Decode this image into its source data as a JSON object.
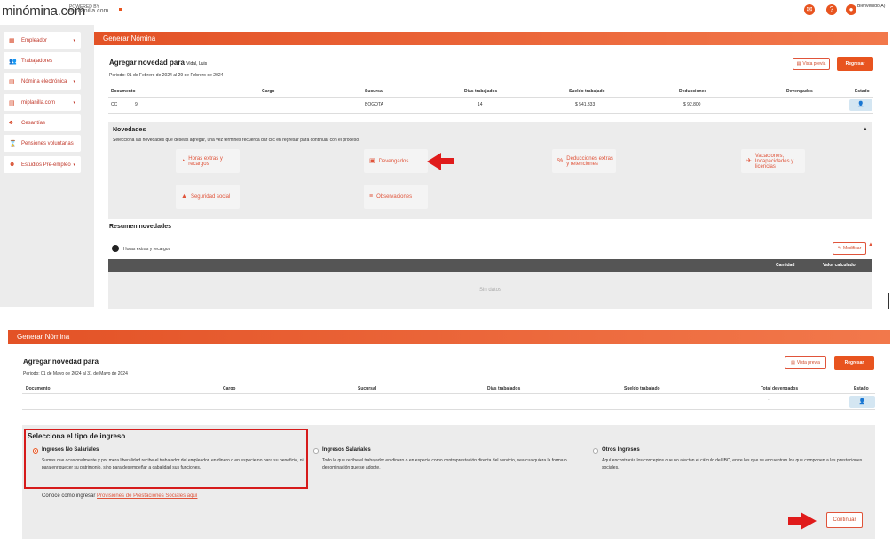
{
  "topbar": {
    "logo": "minómina.com",
    "powered_by": "POWERED BY",
    "partner": "miplanilla.com",
    "welcome": "Bienvenido(A)"
  },
  "sidebar": {
    "items": [
      {
        "label": "Empleador",
        "icon": "building-icon",
        "chevron": "▾"
      },
      {
        "label": "Trabajadores",
        "icon": "users-icon",
        "chevron": ""
      },
      {
        "label": "Nómina electrónica",
        "icon": "document-icon",
        "chevron": "▾"
      },
      {
        "label": "miplanilla.com",
        "icon": "document-icon",
        "chevron": "▾"
      },
      {
        "label": "Cesantías",
        "icon": "piggy-bank-icon",
        "chevron": ""
      },
      {
        "label": "Pensiones voluntarias",
        "icon": "hourglass-icon",
        "chevron": ""
      },
      {
        "label": "Estudios Pre-empleo",
        "icon": "user-check-icon",
        "chevron": "▾"
      }
    ]
  },
  "screen1": {
    "header": "Generar Nómina",
    "title": "Agregar novedad para",
    "employee": "Vidal, Luis",
    "period": "Periodo: 01 de Febrero de 2024 al 29 de Febrero de 2024",
    "preview_label": "Vista previa",
    "back_label": "Regresar",
    "columns": [
      "Documento",
      "Cargo",
      "Sucursal",
      "Días trabajados",
      "Sueldo trabajado",
      "Deducciones",
      "Devengados",
      "Estado"
    ],
    "row": {
      "doc_type": "CC",
      "doc_number": "9",
      "cargo": "",
      "sucursal": "BOGOTA",
      "dias": "14",
      "sueldo": "$ 541.333",
      "deducciones": "$ 92.800",
      "devengados": ""
    },
    "novedades_title": "Novedades",
    "novedades_hint": "Selecciona las novedades que deseas agregar, una vez termines recuerda dar clic en regresar para continuar con el proceso.",
    "novedades": {
      "horas": "Horas extras y recargos",
      "devengados": "Devengados",
      "deducciones": "Deducciones extras y retenciones",
      "vacaciones": "Vacaciones, Incapacidades y licencias",
      "seguridad": "Seguridad social",
      "observaciones": "Observaciones"
    },
    "resumen_title": "Resumen novedades",
    "resumen_item": "Horas extras y recargos",
    "modificar_label": "Modificar",
    "cantidad_label": "Cantidad",
    "valor_label": "Valor calculado",
    "empty_label": "Sin datos"
  },
  "screen2": {
    "header": "Generar Nómina",
    "title": "Agregar novedad para",
    "period": "Periodo: 01 de Mayo de 2024 al 31 de Mayo de 2024",
    "preview_label": "Vista previa",
    "back_label": "Regresar",
    "columns": [
      "Documento",
      "Cargo",
      "Sucursal",
      "Días trabajados",
      "Sueldo trabajado",
      "Total devengados",
      "Estado"
    ],
    "row_total": "-",
    "tipo_title": "Selecciona el tipo de ingreso",
    "options": [
      {
        "label": "Ingresos No Salariales",
        "desc": "Sumas que ocasionalmente y por mera liberalidad recibe el trabajador del empleador, en dinero o en especie no para su beneficio, ni para enriquecer su patrimonio, sino para desempeñar a cabalidad sus funciones.",
        "selected": true
      },
      {
        "label": "Ingresos Salariales",
        "desc": "Todo lo que recibe el trabajador en dinero o en especie como contraprestación directa del servicio, sea cualquiera la forma o denominación que se adopte.",
        "selected": false
      },
      {
        "label": "Otros Ingresos",
        "desc": "Aquí encontrarás los conceptos que no afectan el cálculo del IBC, entre los que se encuentran los que componen a las prestaciones sociales.",
        "selected": false
      }
    ],
    "learn_prefix": "Conoce como ingresar",
    "learn_link": "Provisiones de Prestaciones Sociales aquí",
    "continue_label": "Continuar"
  },
  "colors": {
    "accent": "#e8541f",
    "highlight": "#d61b1b"
  }
}
